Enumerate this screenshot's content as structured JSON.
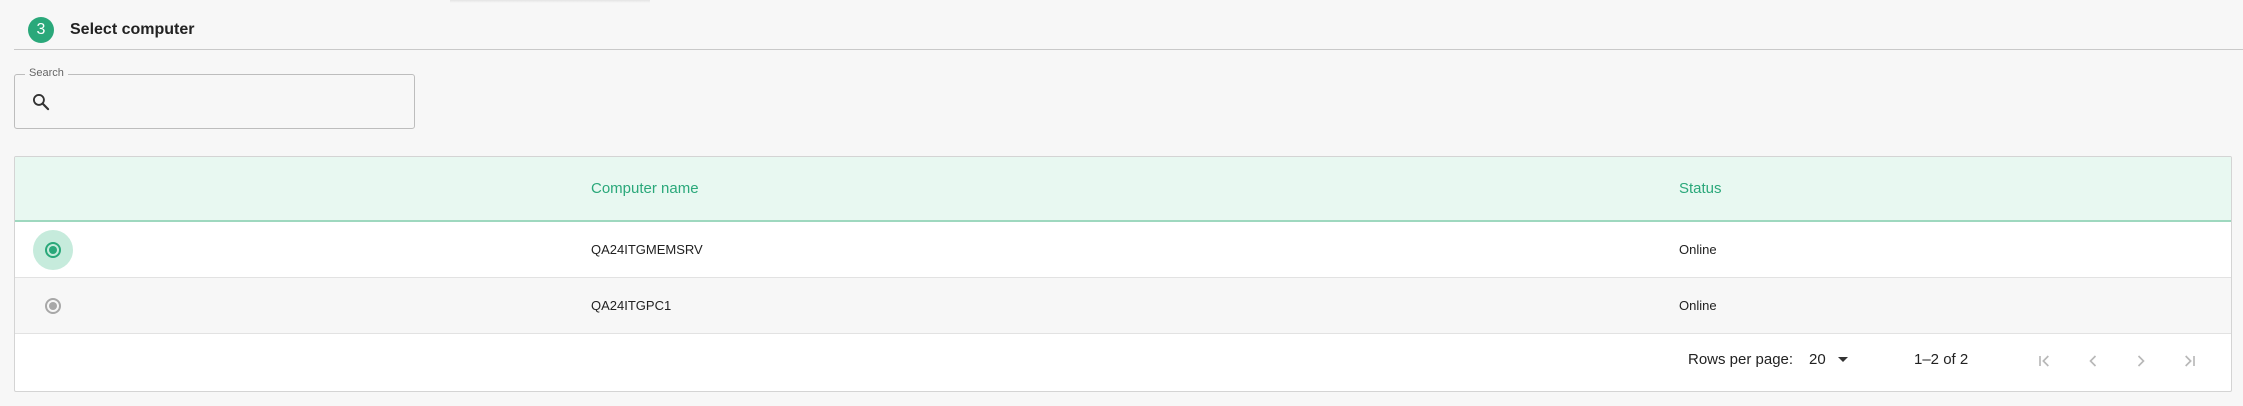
{
  "step": {
    "number": "3",
    "title": "Select computer"
  },
  "search": {
    "label": "Search",
    "value": "",
    "placeholder": ""
  },
  "table": {
    "columns": [
      "",
      "Computer name",
      "Status"
    ],
    "rows": [
      {
        "selected": true,
        "computer_name": "QA24ITGMEMSRV",
        "status": "Online"
      },
      {
        "selected": false,
        "computer_name": "QA24ITGPC1",
        "status": "Online"
      }
    ]
  },
  "pagination": {
    "rows_per_page_label": "Rows per page:",
    "rows_per_page_value": "20",
    "range_label": "1–2 of 2",
    "icons": [
      "first-page-icon",
      "previous-page-icon",
      "next-page-icon",
      "last-page-icon"
    ]
  },
  "colors": {
    "accent": "#2aa87a",
    "header_bg": "#e8f8f1",
    "page_bg": "#f7f7f7",
    "disabled_icon": "#b8b8b8"
  }
}
